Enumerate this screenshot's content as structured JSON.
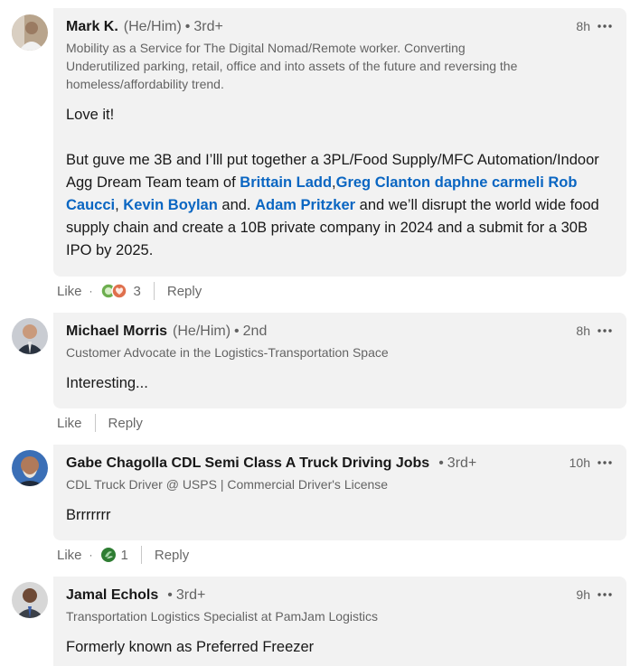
{
  "comments": [
    {
      "name": "Mark K.",
      "pronouns": "(He/Him)",
      "degree": "3rd+",
      "time": "8h",
      "headline_lines": [
        "Mobility as a Service for The Digital Nomad/Remote worker. Converting",
        "Underutilized parking, retail, office and into assets of the future and reversing the",
        "homeless/affordability trend."
      ],
      "body": {
        "p1": "Love it!",
        "t1": "But guve me 3B and I’lll put together a 3PL/Food Supply/MFC Automation/Indoor Agg Dream Team team of ",
        "m1": "Brittain Ladd",
        "t2": ",",
        "m2": "Greg Clanton",
        "t3": " ",
        "m3": "daphne carmeli",
        "t4": " ",
        "m4": "Rob Caucci",
        "t5": ", ",
        "m5": "Kevin Boylan",
        "t6": " and. ",
        "m6": "Adam Pritzker",
        "t7": " and we’ll disrupt the world wide food supply chain and create a 10B private company in 2024 and a submit for a 30B IPO by 2025."
      },
      "actions": {
        "like": "Like",
        "reaction_count": "3",
        "reply": "Reply"
      }
    },
    {
      "name": "Michael Morris",
      "pronouns": "(He/Him)",
      "degree": "2nd",
      "time": "8h",
      "headline": "Customer Advocate in the Logistics-Transportation Space",
      "body": "Interesting...",
      "actions": {
        "like": "Like",
        "reply": "Reply"
      }
    },
    {
      "name": "Gabe Chagolla CDL Semi Class A Truck Driving Jobs",
      "degree": "3rd+",
      "time": "10h",
      "headline": "CDL Truck Driver @ USPS | Commercial Driver's License",
      "body": "Brrrrrrr",
      "actions": {
        "like": "Like",
        "reaction_count": "1",
        "reply": "Reply"
      }
    },
    {
      "name": "Jamal Echols",
      "degree": "3rd+",
      "time": "9h",
      "headline": "Transportation Logistics Specialist at PamJam Logistics",
      "body": "Formerly known as Preferred Freezer"
    }
  ],
  "colors": {
    "bubble": "#f2f2f2",
    "mention": "#0a66c2",
    "secondary_text": "#666666"
  },
  "icons": [
    "more-icon",
    "celebrate-reaction-icon",
    "love-reaction-icon",
    "insightful-reaction-icon"
  ]
}
